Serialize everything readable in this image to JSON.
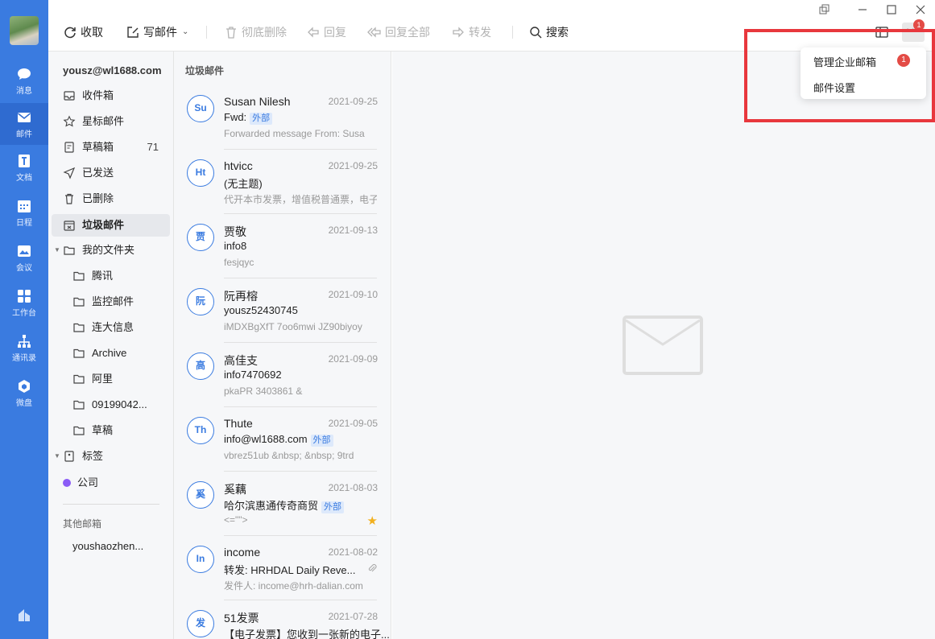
{
  "sidebar": {
    "items": [
      {
        "label": "消息",
        "icon": "chat-icon"
      },
      {
        "label": "邮件",
        "icon": "mail-icon"
      },
      {
        "label": "文档",
        "icon": "document-icon"
      },
      {
        "label": "日程",
        "icon": "calendar-icon"
      },
      {
        "label": "会议",
        "icon": "meeting-icon"
      },
      {
        "label": "工作台",
        "icon": "workbench-icon"
      },
      {
        "label": "通讯录",
        "icon": "contacts-icon"
      },
      {
        "label": "微盘",
        "icon": "drive-icon"
      }
    ],
    "active": "邮件"
  },
  "toolbar": {
    "receive": "收取",
    "compose": "写邮件",
    "delete_permanently": "彻底删除",
    "reply": "回复",
    "reply_all": "回复全部",
    "forward": "转发",
    "search": "搜索"
  },
  "window_badge": "1",
  "folders": {
    "account": "yousz@wl1688.com",
    "items": [
      {
        "label": "收件箱",
        "count": ""
      },
      {
        "label": "星标邮件",
        "count": ""
      },
      {
        "label": "草稿箱",
        "count": "71"
      },
      {
        "label": "已发送",
        "count": ""
      },
      {
        "label": "已删除",
        "count": ""
      },
      {
        "label": "垃圾邮件",
        "count": ""
      }
    ],
    "my_folders_label": "我的文件夹",
    "my_folders": [
      "腾讯",
      "监控邮件",
      "连大信息",
      "Archive",
      "阿里",
      "09199042...",
      "草稿"
    ],
    "tags_label": "标签",
    "tags": [
      {
        "label": "公司",
        "color": "#8b5cf6"
      }
    ],
    "other_label": "其他邮箱",
    "other_account": "youshaozhen..."
  },
  "mail_list": {
    "title": "垃圾邮件",
    "external_tag": "外部",
    "mails": [
      {
        "avatar": "Su",
        "sender": "Susan Nilesh",
        "date": "2021-09-25",
        "subject": "Fwd:",
        "external": true,
        "preview": "Forwarded message From: Susa"
      },
      {
        "avatar": "Ht",
        "sender": "htvicc",
        "date": "2021-09-25",
        "subject": "(无主题)",
        "external": false,
        "preview": "代开本市发票，增值税普通票，电子"
      },
      {
        "avatar": "贾",
        "sender": "贾敬",
        "date": "2021-09-13",
        "subject": "info8",
        "external": false,
        "preview": "fesjqyc"
      },
      {
        "avatar": "阮",
        "sender": "阮再榕",
        "date": "2021-09-10",
        "subject": "yousz52430745",
        "external": false,
        "preview": "iMDXBgXfT 7oo6mwi JZ90biyoy"
      },
      {
        "avatar": "高",
        "sender": "高佳支",
        "date": "2021-09-09",
        "subject": "info7470692",
        "external": false,
        "preview": "pkaPR 3403861 &"
      },
      {
        "avatar": "Th",
        "sender": "Thute",
        "date": "2021-09-05",
        "subject": "info@wl1688.com",
        "external": true,
        "preview": "vbrez51ub &nbsp; &nbsp; 9trd"
      },
      {
        "avatar": "奚",
        "sender": "奚藕",
        "date": "2021-08-03",
        "subject": "哈尔滨惠通传奇商贸",
        "external": true,
        "preview": "<=\"\">",
        "starred": true
      },
      {
        "avatar": "In",
        "sender": "income",
        "date": "2021-08-02",
        "subject": "转发: HRHDAL Daily Reve...",
        "external": false,
        "preview": "发件人: income@hrh-dalian.com",
        "attachment": true
      },
      {
        "avatar": "发",
        "sender": "51发票",
        "date": "2021-07-28",
        "subject": "【电子发票】您收到一张新的电子...",
        "external": false,
        "preview": ""
      }
    ]
  },
  "menu": {
    "items": [
      "管理企业邮箱",
      "邮件设置"
    ],
    "badge": "1"
  }
}
